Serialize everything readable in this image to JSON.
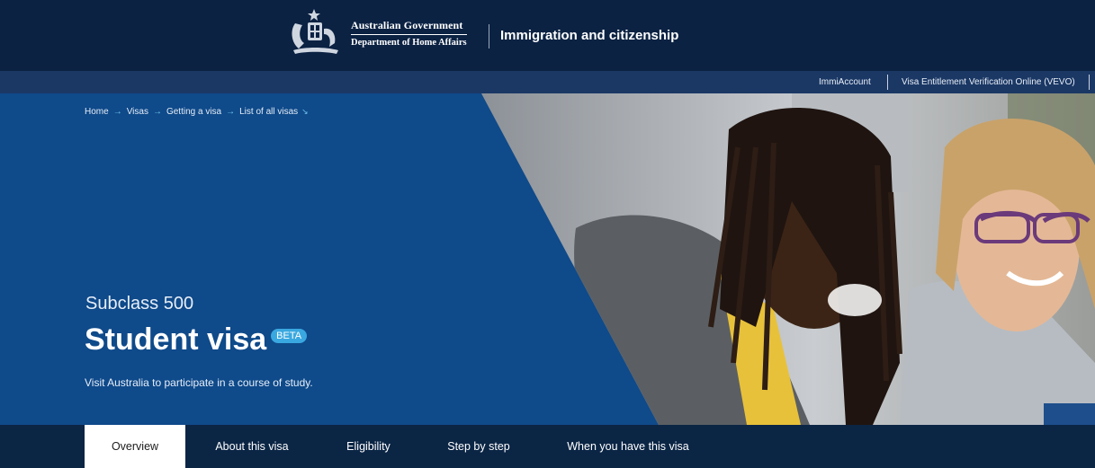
{
  "header": {
    "gov_line1": "Australian Government",
    "gov_line2": "Department of Home Affairs",
    "site_title": "Immigration and citizenship"
  },
  "utility": {
    "links": [
      "ImmiAccount",
      "Visa Entitlement Verification Online (VEVO)"
    ]
  },
  "breadcrumb": {
    "items": [
      "Home",
      "Visas",
      "Getting a visa",
      "List of all visas"
    ],
    "arrow": "→",
    "expand": "↘"
  },
  "hero": {
    "subclass": "Subclass 500",
    "title": "Student visa",
    "badge": "BETA",
    "description": "Visit Australia to participate in a course of study."
  },
  "tabs": [
    "Overview",
    "About this visa",
    "Eligibility",
    "Step by step",
    "When you have this visa"
  ],
  "active_tab": "Overview",
  "colors": {
    "header_bg": "#0b2243",
    "utility_bg": "#1b3865",
    "hero_blue": "#0f4a8a",
    "tab_bar_bg": "#0b2545",
    "accent": "#3aa8e0"
  }
}
